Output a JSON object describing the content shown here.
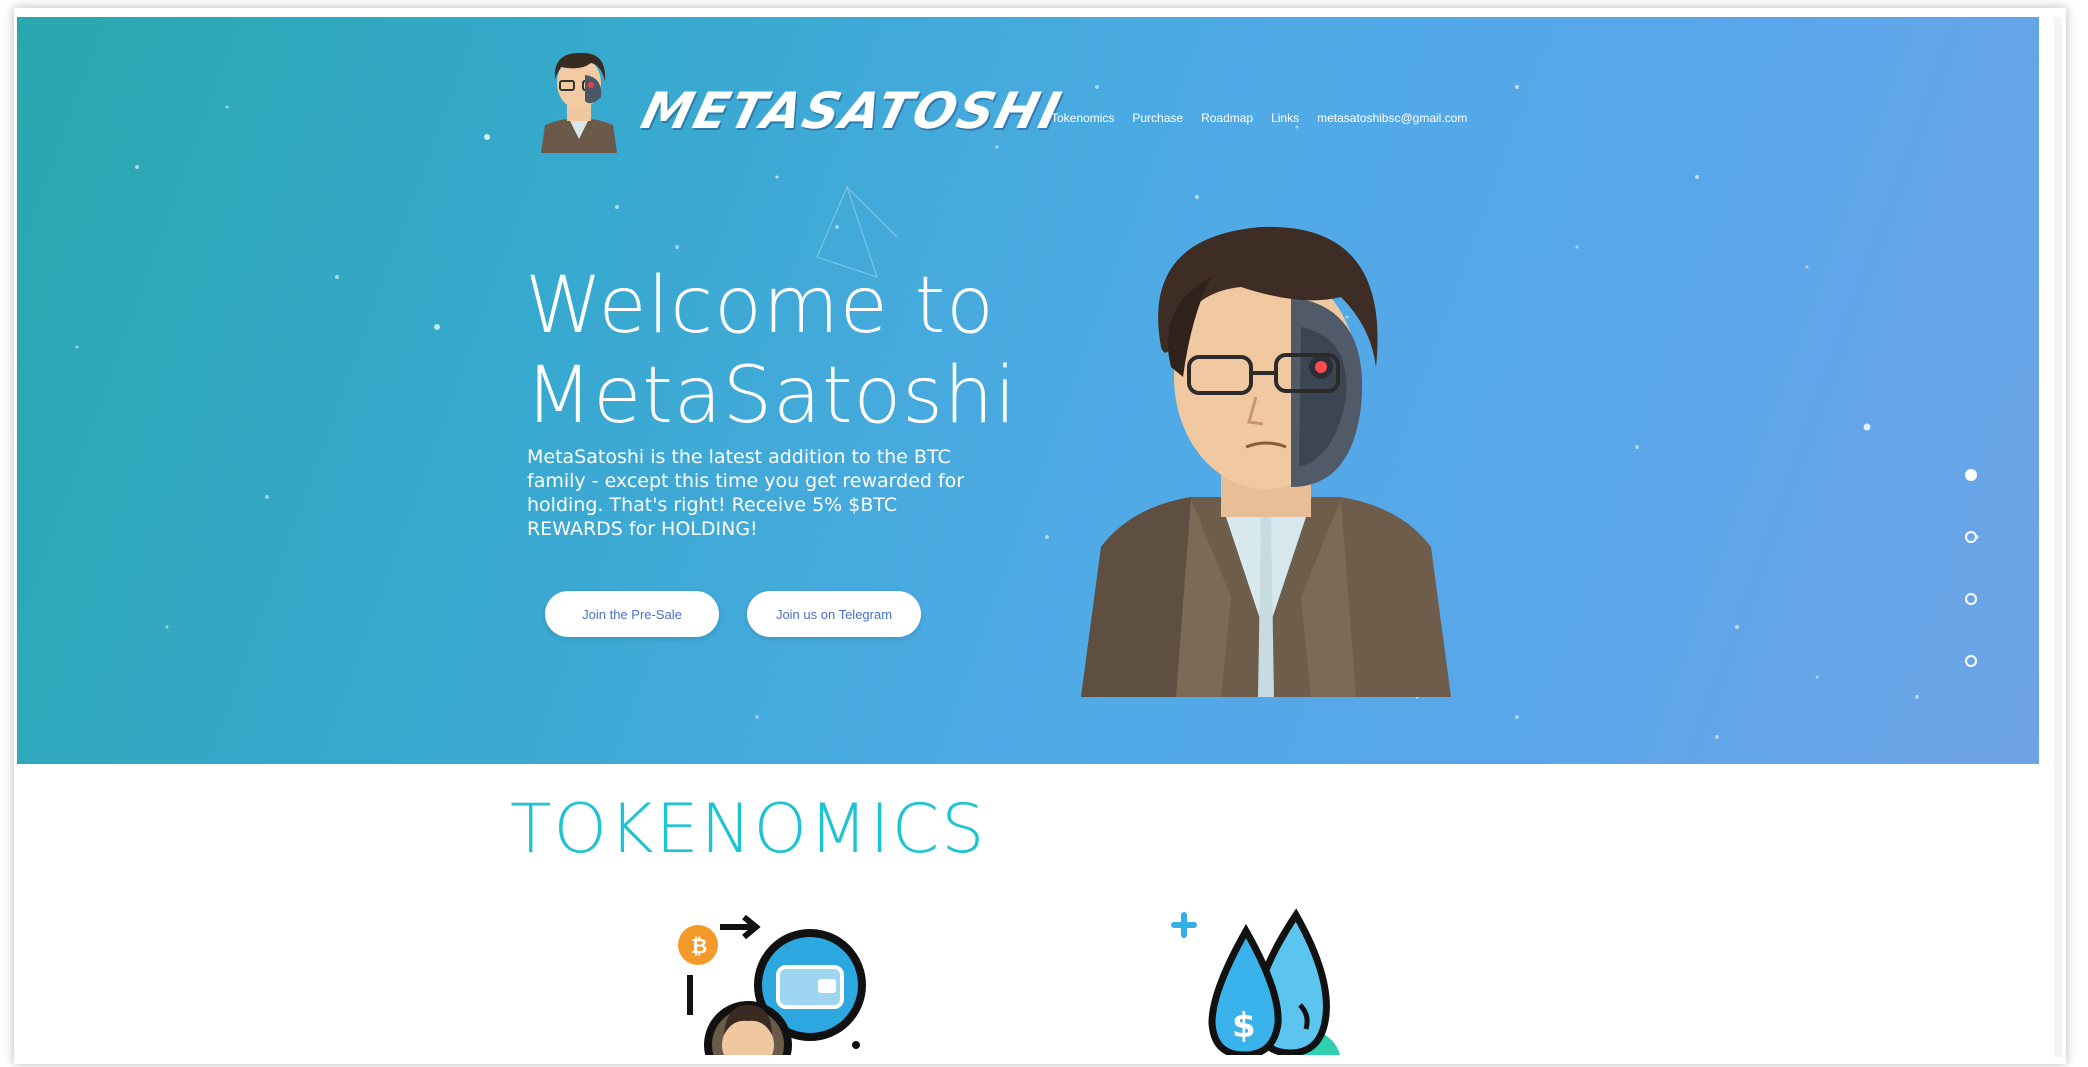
{
  "brand": {
    "wordmark": "METASATOSHI"
  },
  "nav": {
    "items": [
      "Tokenomics",
      "Purchase",
      "Roadmap",
      "Links",
      "metasatoshibsc@gmail.com"
    ]
  },
  "hero": {
    "title_line1": "Welcome to",
    "title_line2": "MetaSatoshi",
    "intro": "MetaSatoshi is the latest addition to the BTC family - except this time you get rewarded for holding. That's right! Receive 5% $BTC REWARDS for HOLDING!",
    "presale_button": "Join the Pre-Sale",
    "telegram_button": "Join us on Telegram",
    "slide_count": 4,
    "active_slide": 1
  },
  "tokenomics": {
    "title": "TOKENOMICS"
  },
  "colors": {
    "accent_cyan": "#1fc3d2",
    "button_text": "#4a6fd0",
    "hero_start": "#2aa7ae",
    "hero_end": "#6fa4e6"
  }
}
